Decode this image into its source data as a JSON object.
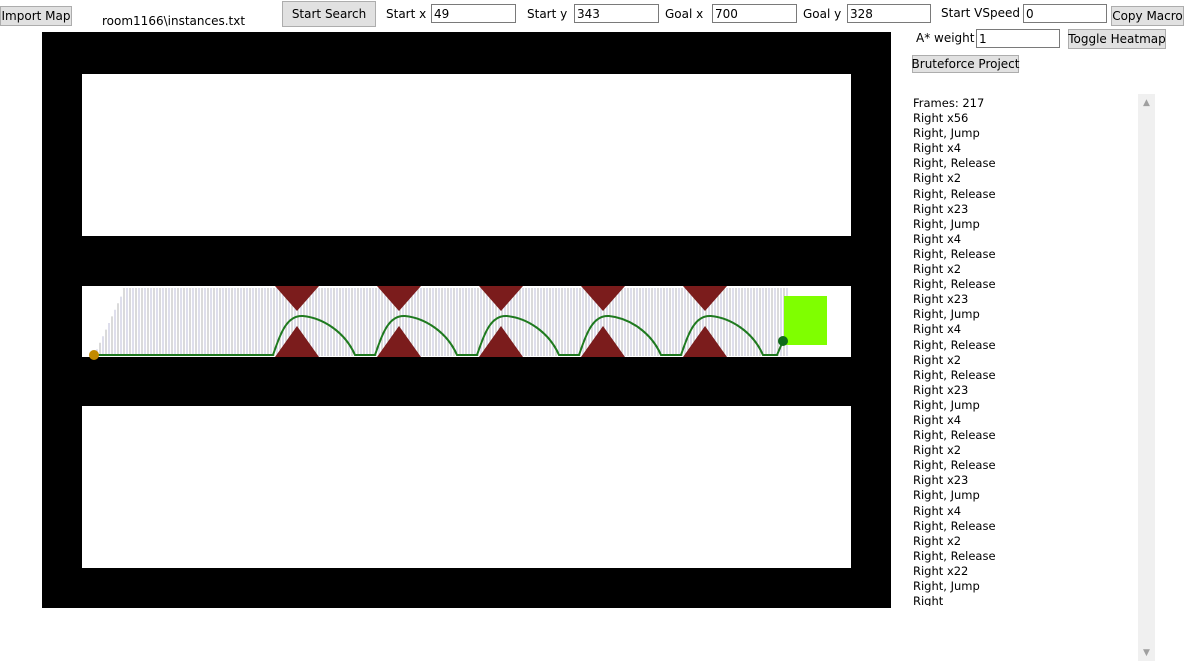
{
  "toolbar": {
    "import_map": "Import Map",
    "map_path": "room1166\\instances.txt",
    "start_search": "Start Search",
    "start_x_label": "Start x",
    "start_x": "49",
    "start_y_label": "Start y",
    "start_y": "343",
    "goal_x_label": "Goal x",
    "goal_x": "700",
    "goal_y_label": "Goal y",
    "goal_y": "328",
    "start_vspeed_label": "Start VSpeed",
    "start_vspeed": "0",
    "copy_macro": "Copy Macro",
    "astar_weight_label": "A* weight",
    "astar_weight": "1",
    "toggle_heatmap": "Toggle Heatmap",
    "bruteforce_project": "Bruteforce Project"
  },
  "colors": {
    "wall": "#000000",
    "spike": "#7b1c1c",
    "path": "#1f7a1f",
    "goal": "#7fff00",
    "start_marker": "#c28a00",
    "end_marker": "#0e6a1a",
    "search_lines": "#2a2a7a"
  },
  "output": {
    "lines": [
      "Frames: 217",
      "Right x56",
      "Right, Jump",
      "Right x4",
      "Right, Release",
      "Right x2",
      "Right, Release",
      "Right x23",
      "Right, Jump",
      "Right x4",
      "Right, Release",
      "Right x2",
      "Right, Release",
      "Right x23",
      "Right, Jump",
      "Right x4",
      "Right, Release",
      "Right x2",
      "Right, Release",
      "Right x23",
      "Right, Jump",
      "Right x4",
      "Right, Release",
      "Right x2",
      "Right, Release",
      "Right x23",
      "Right, Jump",
      "Right x4",
      "Right, Release",
      "Right x2",
      "Right, Release",
      "Right x22",
      "Right, Jump",
      "Right"
    ]
  },
  "scrollbar": {
    "up_icon": "chevron-up-icon",
    "down_icon": "chevron-down-icon"
  }
}
